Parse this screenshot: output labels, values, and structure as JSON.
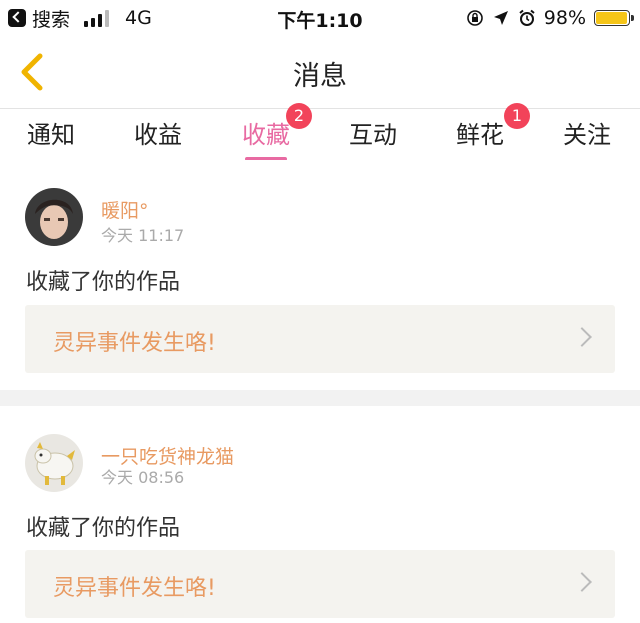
{
  "status_bar": {
    "back_app_label": "搜索",
    "network": "4G",
    "time": "下午1:10",
    "battery_percent_label": "98%",
    "battery_level": 0.98,
    "battery_color": "#f5c518"
  },
  "header": {
    "title": "消息",
    "back_icon": "chevron-left-icon"
  },
  "tabs": [
    {
      "label": "通知",
      "badge": null,
      "active": false
    },
    {
      "label": "收益",
      "badge": null,
      "active": false
    },
    {
      "label": "收藏",
      "badge": "2",
      "active": true
    },
    {
      "label": "互动",
      "badge": null,
      "active": false
    },
    {
      "label": "鲜花",
      "badge": "1",
      "active": false
    },
    {
      "label": "关注",
      "badge": null,
      "active": false
    }
  ],
  "colors": {
    "accent": "#e86aa2",
    "username": "#e89a62",
    "badge": "#f2435a"
  },
  "messages": [
    {
      "username": "暖阳°",
      "time": "今天 11:17",
      "action": "收藏了你的作品",
      "work_title": "灵异事件发生咯!"
    },
    {
      "username": "一只吃货神龙猫",
      "time": "今天 08:56",
      "action": "收藏了你的作品",
      "work_title": "灵异事件发生咯!"
    }
  ]
}
